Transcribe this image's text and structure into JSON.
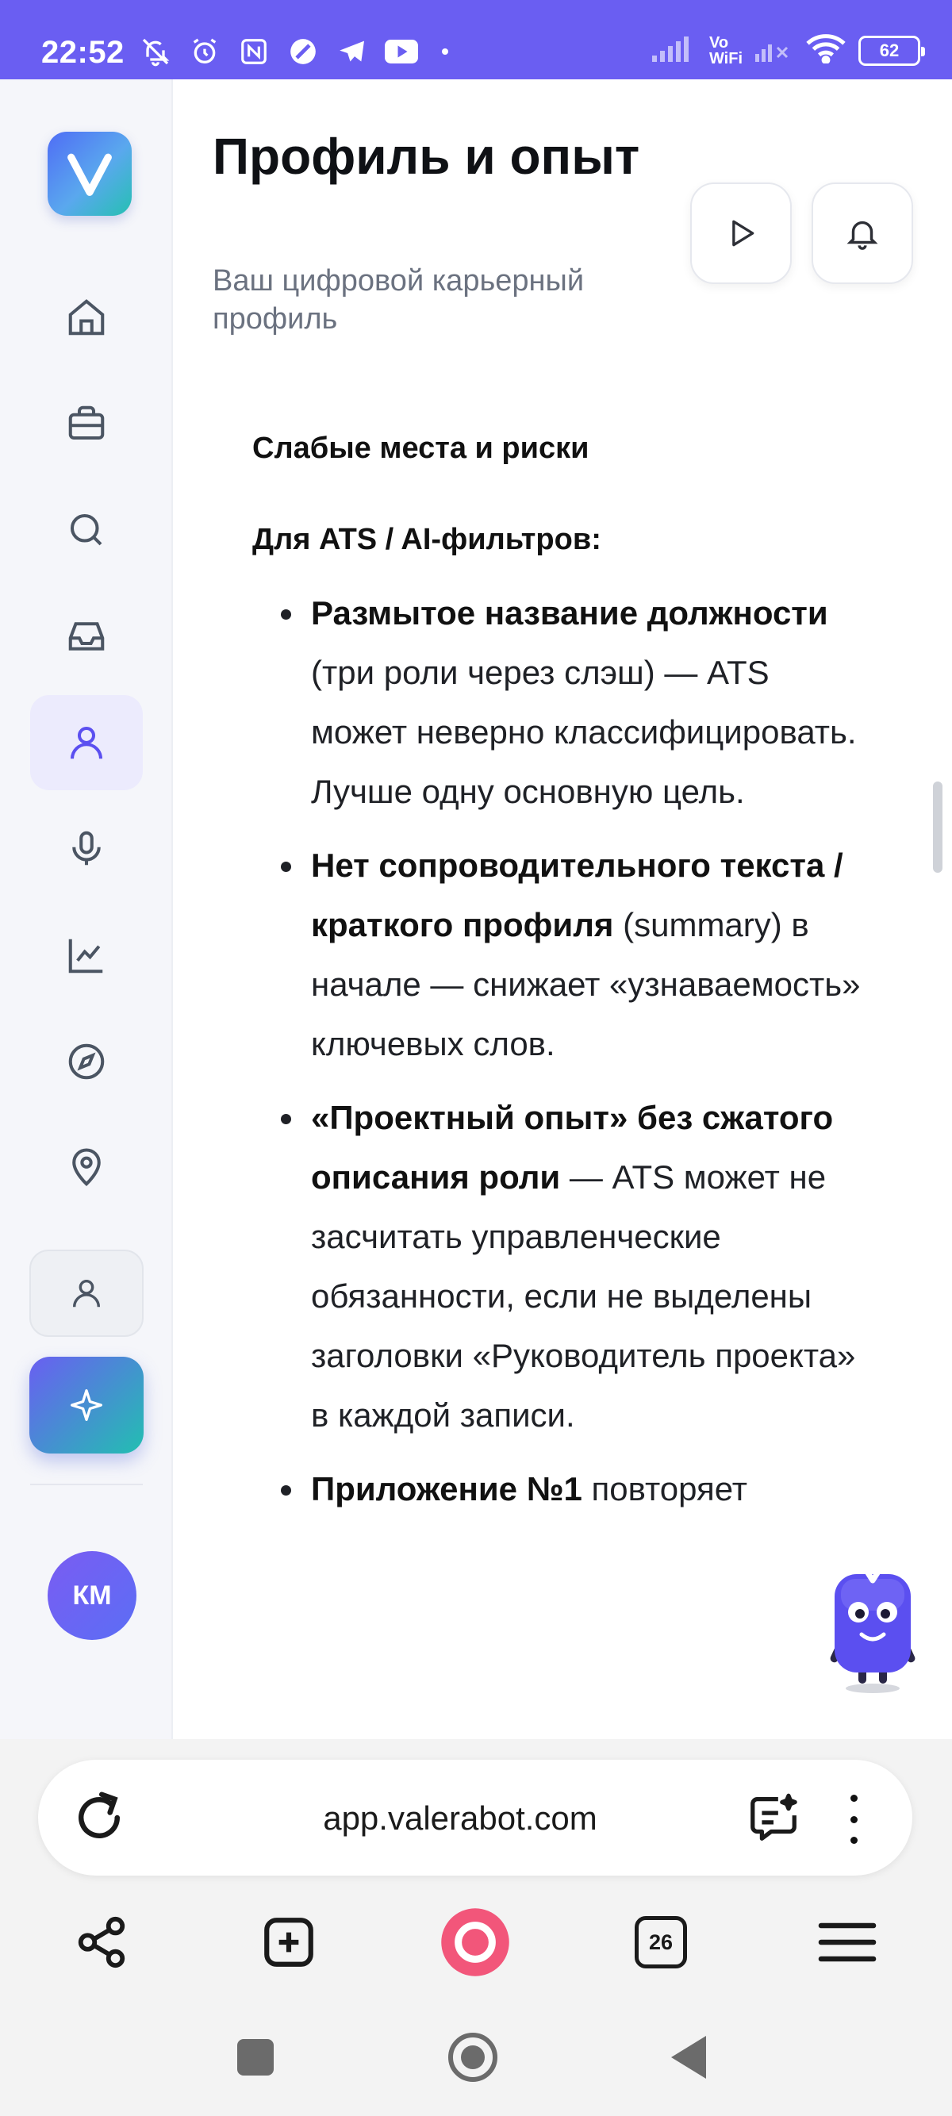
{
  "status_bar": {
    "time": "22:52",
    "volte_top": "Vo",
    "volte_bottom": "WiFi",
    "battery": "62",
    "icons": [
      "mute-icon",
      "alarm-icon",
      "nfc-icon",
      "app-icon",
      "telegram-icon",
      "youtube-icon",
      "signal-icon",
      "wifi-icon",
      "battery-icon"
    ]
  },
  "sidebar": {
    "logo_letter": "V",
    "items": [
      {
        "name": "home",
        "icon": "home-icon"
      },
      {
        "name": "jobs",
        "icon": "briefcase-icon"
      },
      {
        "name": "search",
        "icon": "search-icon"
      },
      {
        "name": "inbox",
        "icon": "inbox-icon"
      },
      {
        "name": "profile",
        "icon": "user-icon",
        "active": true
      },
      {
        "name": "interview",
        "icon": "microphone-icon"
      },
      {
        "name": "analytics",
        "icon": "chart-icon"
      },
      {
        "name": "explore",
        "icon": "compass-icon"
      },
      {
        "name": "location",
        "icon": "location-pin-icon"
      }
    ],
    "avatar_initials": "КМ"
  },
  "header": {
    "title": "Профиль и опыт",
    "subtitle": "Ваш цифровой карьерный профиль"
  },
  "content": {
    "section_title": "Слабые места и риски",
    "subsection_title": "Для ATS / AI-фильтров:",
    "bullets": [
      {
        "bold": "Размытое название должности",
        "rest": " (три роли через слэш) — ATS может неверно классифицировать. Лучше одну основную цель."
      },
      {
        "bold": "Нет сопроводительного текста / краткого профиля",
        "rest": " (summary) в начале — снижает «узнаваемость» ключевых слов."
      },
      {
        "bold": "«Проектный опыт» без сжатого описания роли",
        "rest": " — ATS может не засчитать управленческие обязанности, если не выделены заголовки «Руководитель проекта» в каждой записи."
      },
      {
        "bold": "Приложение №1",
        "rest": " повторяет"
      }
    ]
  },
  "browser": {
    "url": "app.valerabot.com",
    "tabs_count": "26"
  },
  "colors": {
    "accent": "#6a5ef2",
    "teal": "#22bfb1",
    "alice_pink": "#f2567a"
  }
}
